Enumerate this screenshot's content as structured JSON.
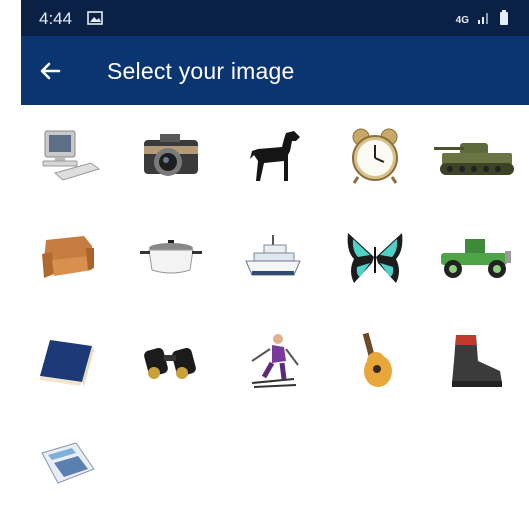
{
  "status_bar": {
    "time": "4:44",
    "network": "4G",
    "icons": [
      "image-notification-icon",
      "network-4g-icon",
      "signal-icon",
      "battery-icon"
    ]
  },
  "app_bar": {
    "title": "Select your image",
    "back_icon": "back-arrow-icon"
  },
  "images": [
    "computer",
    "camera",
    "dog",
    "alarm-clock",
    "tank",
    "sofa",
    "cooking-pot",
    "boat",
    "butterfly",
    "vintage-car",
    "book",
    "binoculars",
    "skier",
    "guitar",
    "boot",
    "calculator"
  ],
  "colors": {
    "status_bar": "#0a2145",
    "app_bar": "#0b3570",
    "background": "#ffffff"
  }
}
